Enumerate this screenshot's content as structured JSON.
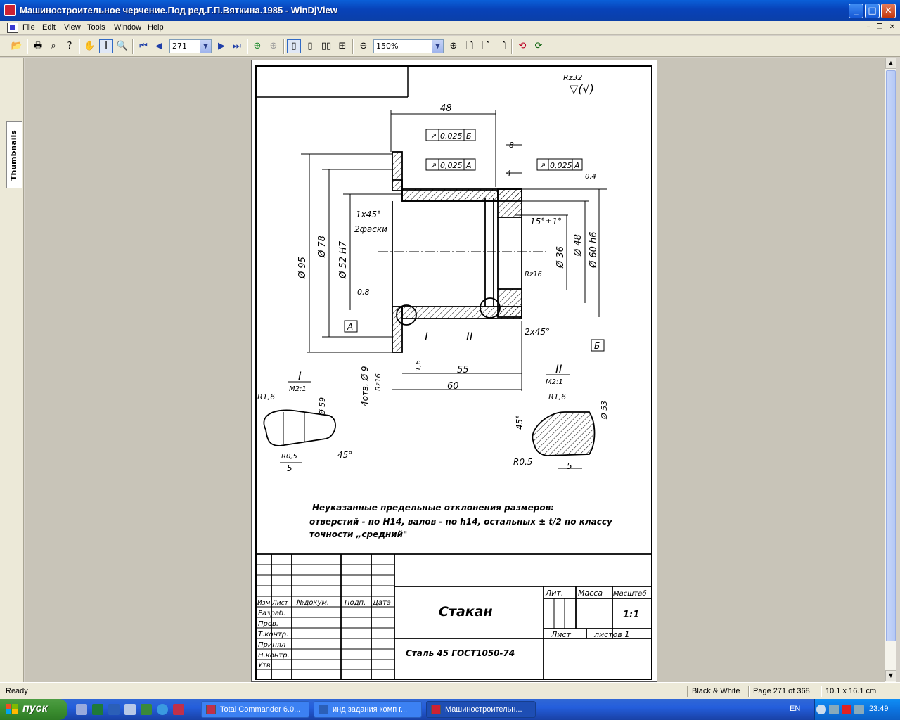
{
  "window": {
    "title": "Машиностроительное черчение.Под ред.Г.П.Вяткина.1985 - WinDjView"
  },
  "menu": {
    "file": "File",
    "edit": "Edit",
    "view": "View",
    "tools": "Tools",
    "window": "Window",
    "help": "Help"
  },
  "toolbar": {
    "page_value": "271",
    "zoom_value": "150%"
  },
  "sidebar": {
    "tab_label": "Thumbnails"
  },
  "drawing": {
    "roughness_top": "Rz32",
    "d48": "48",
    "d8": "8",
    "d4": "4",
    "tol1": "0,025",
    "tol1_ref": "Б",
    "tol2": "0,025",
    "tol2_ref": "А",
    "tol3": "0,025",
    "tol3_ref": "А",
    "r04": "0,4",
    "chamfer1": "1x45°",
    "chamfer1_note": "2фаски",
    "angle15": "15°±1°",
    "rz16a": "Rz16",
    "rz16b": "Rz16",
    "r08": "0,8",
    "d95": "Ø 95",
    "d78": "Ø 78",
    "d52": "Ø 52 H7",
    "d36": "Ø 36",
    "d48b": "Ø 48",
    "d60": "Ø 60 h6",
    "datum_a": "А",
    "datum_b": "Б",
    "view1": "I",
    "view2": "II",
    "chamfer2": "2x45°",
    "holes": "4отв. Ø 9",
    "r16": "1,6",
    "d55": "55",
    "d60len": "60",
    "detail1_title": "I",
    "detail1_scale": "M2:1",
    "detail1_r16": "R1,6",
    "detail1_d59": "Ø 59",
    "detail1_r05": "R0,5",
    "detail1_angle": "45°",
    "detail1_5": "5",
    "detail2_title": "II",
    "detail2_scale": "M2:1",
    "detail2_r16": "R1,6",
    "detail2_angle": "45°",
    "detail2_d53": "Ø 53",
    "detail2_r05": "R0,5",
    "detail2_5": "5",
    "note_line1": "Неуказанные предельные отклонения размеров:",
    "note_line2": "отверстий - по Н14, валов - по h14, остальных ± t/2 по классу",
    "note_line3": "точности „средний\""
  },
  "stamp": {
    "izm": "Изм",
    "list": "Лист",
    "doc": "№докум.",
    "sign": "Подп.",
    "date": "Дата",
    "razrab": "Разраб.",
    "prov": "Пров.",
    "tkontr": "Т.контр.",
    "prinyal": "Принял",
    "nkontr": "Н.контр.",
    "utv": "Утв.",
    "title": "Стакан",
    "material": "Сталь 45 ГОСТ1050-74",
    "lit": "Лит.",
    "massa": "Масса",
    "scale": "Масштаб",
    "scale_value": "1:1",
    "sheet": "Лист",
    "sheets": "листов 1"
  },
  "status": {
    "ready": "Ready",
    "mode": "Black & White",
    "page": "Page 271 of 368",
    "size": "10.1 x 16.1 cm"
  },
  "taskbar": {
    "start": "пуск",
    "task1": "Total Commander 6.0...",
    "task2": "инд задания комп г...",
    "task3": "Машиностроительн...",
    "lang": "EN",
    "clock": "23:49"
  }
}
